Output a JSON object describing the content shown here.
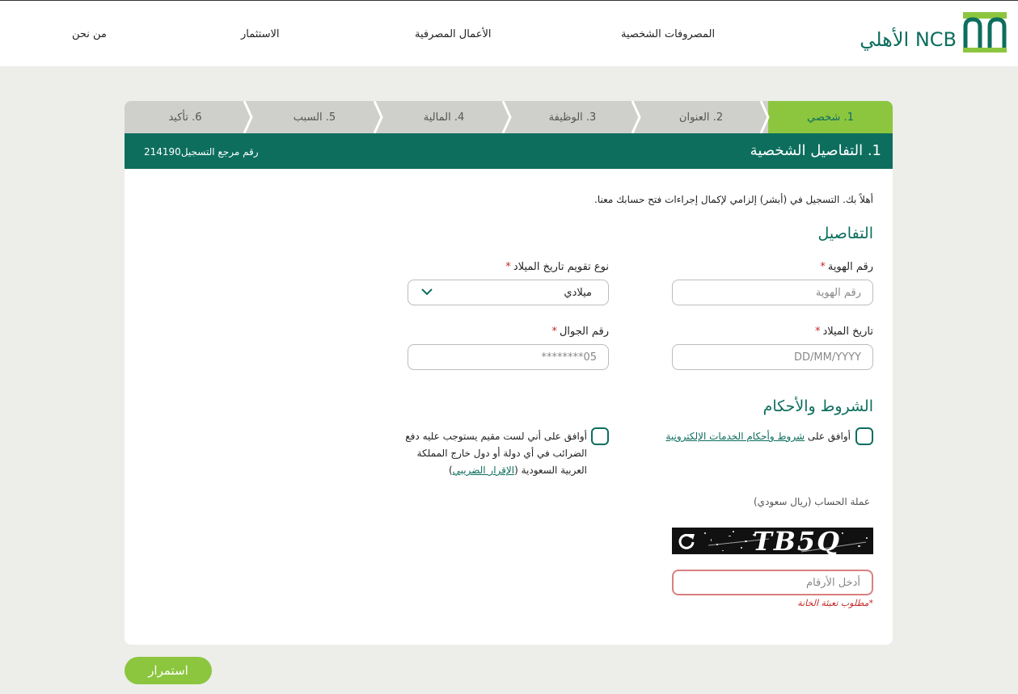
{
  "colors": {
    "brand": "#0d6e5e",
    "accent": "#8cc63f",
    "error": "#c62828"
  },
  "header": {
    "logo_text": "الأهلي NCB",
    "nav": [
      {
        "label": "المصروفات الشخصية"
      },
      {
        "label": "الأعمال المصرفية"
      },
      {
        "label": "الاستثمار"
      },
      {
        "label": "من نحن"
      }
    ]
  },
  "steps": [
    {
      "label": "1. شخصي",
      "active": true
    },
    {
      "label": "2. العنوان"
    },
    {
      "label": "3. الوظيفة"
    },
    {
      "label": "4. المالية"
    },
    {
      "label": "5. السبب"
    },
    {
      "label": "6. تأكيد"
    }
  ],
  "banner": {
    "title": "1. التفاصيل الشخصية",
    "ref_label": "رقم مرجع التسجيل",
    "ref_value": "214190"
  },
  "form": {
    "intro": "أهلاً بك. التسجيل في (أبشر) إلزامي لإكمال إجراءات فتح حسابك معنا.",
    "details_title": "التفاصيل",
    "id_number": {
      "label": "رقم الهوية",
      "placeholder": "رقم الهوية"
    },
    "calendar_type": {
      "label": "نوع تقويم تاريخ الميلاد",
      "value": "ميلادي"
    },
    "birth_date": {
      "label": "تاريخ الميلاد",
      "placeholder": "DD/MM/YYYY"
    },
    "mobile": {
      "label": "رقم الجوال",
      "placeholder": "05********"
    },
    "required_mark": "*",
    "terms_title": "الشروط والأحكام",
    "terms_agree_prefix": "أوافق على",
    "terms_agree_link": "شروط وأحكام الخدمات الإلكترونية",
    "tax_line1": "أوافق على أني لست مقيم يستوجب عليه دفع",
    "tax_line2": "الضرائب في أي دولة أو دول خارج المملكة",
    "tax_line3_prefix": "العربية السعودية (",
    "tax_link": "الإقرار الضريبي",
    "tax_line3_suffix": ")",
    "currency": "عملة الحساب (ريال سعودي)",
    "captcha_text": "TB5Q",
    "captcha_input": {
      "placeholder": "أدخل الأرقام"
    },
    "error_msg": "*مطلوب تعبئة الخانة"
  },
  "continue_label": "استمرار"
}
